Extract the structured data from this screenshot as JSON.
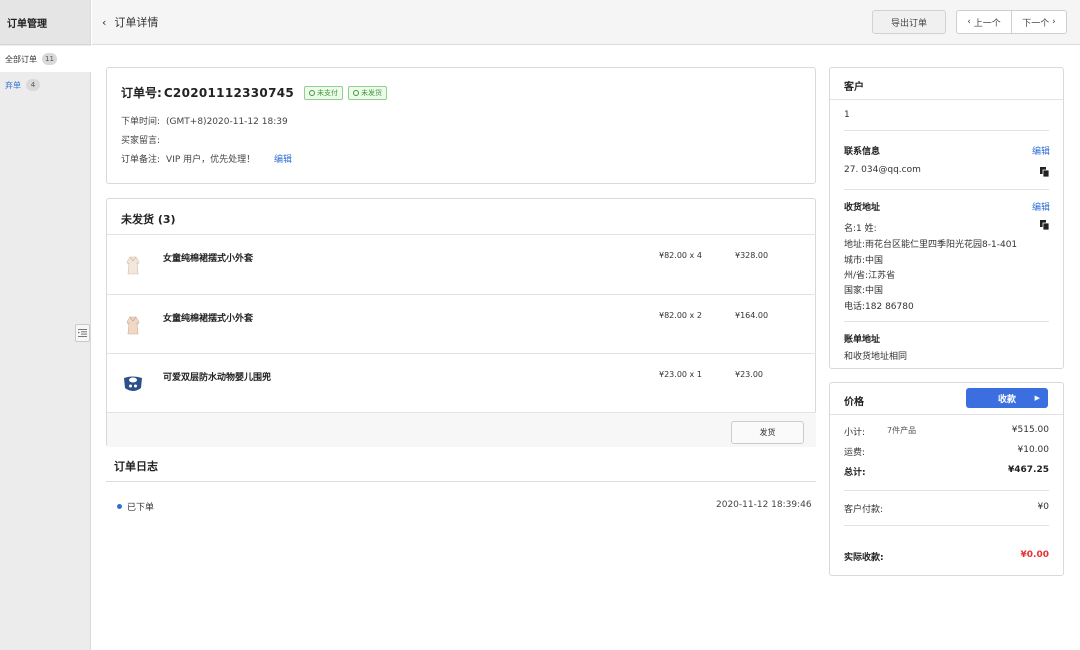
{
  "sidebar": {
    "title": "订单管理",
    "items": [
      {
        "label": "全部订单",
        "count": "11"
      },
      {
        "label": "弃单",
        "count": "4"
      }
    ]
  },
  "header": {
    "back_label": "订单详情",
    "export_label": "导出订单",
    "prev_label": "上一个",
    "next_label": "下一个"
  },
  "order": {
    "number_label": "订单号:",
    "number": "C20201112330745",
    "tags": [
      "未支付",
      "未发货"
    ],
    "time_label": "下单时间:",
    "time_value": "(GMT+8)2020-11-12 18:39",
    "message_label": "买家留言:",
    "note_label": "订单备注:",
    "note_value": "VIP 用户，优先处理！",
    "edit_label": "编辑"
  },
  "unshipped": {
    "title": "未发货 (3)",
    "items": [
      {
        "name": "女童纯棉裙摆式小外套",
        "price": "¥82.00 x 4",
        "total": "¥328.00",
        "icon": "jacket-icon"
      },
      {
        "name": "女童纯棉裙摆式小外套",
        "price": "¥82.00 x 2",
        "total": "¥164.00",
        "icon": "jacket-icon"
      },
      {
        "name": "可爱双层防水动物婴儿围兜",
        "price": "¥23.00 x 1",
        "total": "¥23.00",
        "icon": "bib-icon"
      }
    ],
    "ship_label": "发货"
  },
  "log": {
    "title": "订单日志",
    "entries": [
      {
        "label": "已下单",
        "time": "2020-11-12 18:39:46"
      }
    ]
  },
  "customer": {
    "title": "客户",
    "value": "1",
    "contact_title": "联系信息",
    "contact_edit": "编辑",
    "contact_email": "27.  034@qq.com",
    "ship_title": "收货地址",
    "ship_edit": "编辑",
    "ship_lines": [
      "名:1 姓:",
      "地址:雨花台区能仁里四季阳光花园8-1-401",
      "城市:中国",
      "州/省:江苏省",
      "国家:中国",
      "电话:182  86780"
    ],
    "bill_title": "账单地址",
    "bill_value": "和收货地址相同"
  },
  "price": {
    "title": "价格",
    "pay_label": "收款",
    "subtotal_label": "小计:",
    "subtotal_items": "7件产品",
    "subtotal": "¥515.00",
    "shipping_label": "运费:",
    "shipping": "¥10.00",
    "total_label": "总计:",
    "total": "¥467.25",
    "paid_label": "客户付款:",
    "paid": "¥0",
    "actual_label": "实际收款:",
    "actual": "¥0.00"
  },
  "colors": {
    "accent": "#3b6fe0",
    "link": "#2f6fd6",
    "tag_green": "#3d9b35",
    "amount_red": "#e8312f"
  }
}
